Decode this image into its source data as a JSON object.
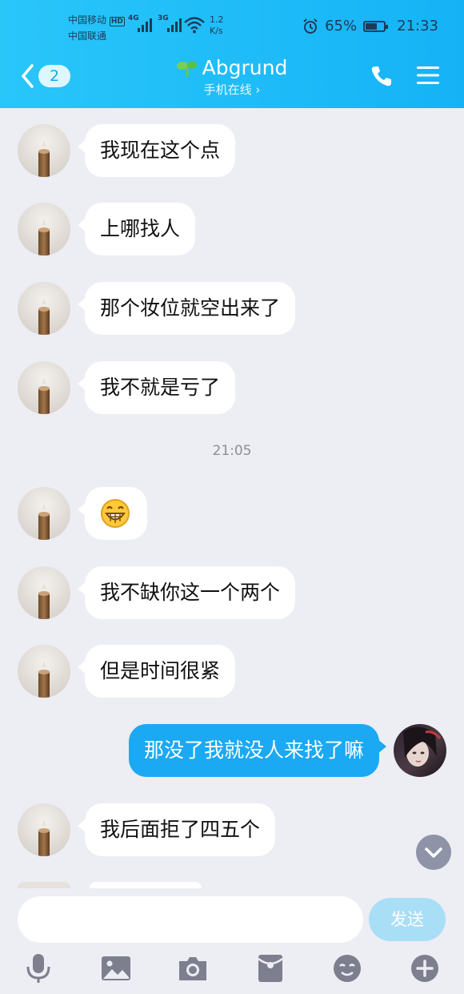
{
  "status_bar": {
    "carrier1": "中国移动",
    "carrier1_badge": "HD",
    "carrier2": "中国联通",
    "net1": "4G",
    "net2": "3G",
    "speed_value": "1.2",
    "speed_unit": "K/s",
    "battery": "65%",
    "battery_level": 0.65,
    "time": "21:33"
  },
  "header": {
    "unread_count": "2",
    "contact_name": "Abgrund",
    "status": "手机在线 ›"
  },
  "messages": [
    {
      "side": "left",
      "text": "我现在这个点"
    },
    {
      "side": "left",
      "text": "上哪找人"
    },
    {
      "side": "left",
      "text": "那个妆位就空出来了"
    },
    {
      "side": "left",
      "text": "我不就是亏了"
    },
    {
      "type": "timestamp",
      "text": "21:05"
    },
    {
      "side": "left",
      "type": "emoji",
      "emoji": "grinning-face-emoji"
    },
    {
      "side": "left",
      "text": "我不缺你这一个两个"
    },
    {
      "side": "left",
      "text": "但是时间很紧"
    },
    {
      "side": "right",
      "text": "那没了我就没人来找了嘛"
    },
    {
      "side": "left",
      "text": "我后面拒了四五个"
    }
  ],
  "composer": {
    "input_value": "",
    "send_label": "发送"
  },
  "toolbar": [
    "microphone-icon",
    "image-icon",
    "camera-icon",
    "red-packet-icon",
    "emoji-face-icon",
    "plus-icon"
  ],
  "colors": {
    "header": "#1cb8f7",
    "bubble_self": "#1aa9f2",
    "background": "#ededf4",
    "send_button": "#a9def7"
  }
}
